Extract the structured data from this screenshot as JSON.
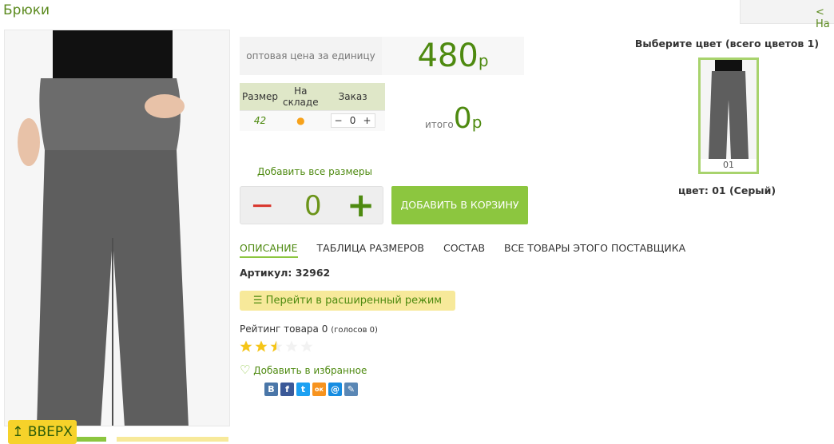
{
  "page": {
    "title": "Брюки",
    "back": "< На"
  },
  "price": {
    "label": "оптовая цена за единицу",
    "value": "480",
    "currency": "р"
  },
  "sizes": {
    "headers": [
      "Размер",
      "На складе",
      "Заказ"
    ],
    "rows": [
      {
        "size": "42",
        "stock": "●",
        "qty": "0",
        "minus": "−",
        "plus": "+"
      }
    ]
  },
  "total": {
    "label": "итого",
    "value": "0",
    "currency": "р"
  },
  "add_all_sizes": "Добавить все размеры",
  "big_stepper": {
    "minus": "−",
    "value": "0",
    "plus": "+"
  },
  "add_to_cart": "ДОБАВИТЬ В КОРЗИНУ",
  "tabs": [
    {
      "label": "ОПИСАНИЕ",
      "active": true
    },
    {
      "label": "ТАБЛИЦА РАЗМЕРОВ"
    },
    {
      "label": "СОСТАВ"
    },
    {
      "label": "ВСЕ ТОВАРЫ ЭТОГО ПОСТАВЩИКА"
    }
  ],
  "article": "Артикул: 32962",
  "advanced_mode": "Перейти в расширенный режим",
  "rating": {
    "text": "Рейтинг товара 0",
    "votes": "(голосов 0)",
    "stars": 2.5,
    "max": 5
  },
  "favorite": "Добавить в избранное",
  "share": [
    {
      "icon": "vk-icon",
      "glyph": "В",
      "color": "#4a76a8"
    },
    {
      "icon": "facebook-icon",
      "glyph": "f",
      "color": "#3b5998"
    },
    {
      "icon": "twitter-icon",
      "glyph": "t",
      "color": "#1da1f2"
    },
    {
      "icon": "odnoklassniki-icon",
      "glyph": "ок",
      "color": "#f7931e"
    },
    {
      "icon": "mailru-icon",
      "glyph": "@",
      "color": "#168de2"
    },
    {
      "icon": "livejournal-icon",
      "glyph": "✎",
      "color": "#5a87b5"
    }
  ],
  "colors": {
    "title": "Выберите цвет (всего цветов 1)",
    "swatch_label": "01",
    "selected": "цвет: 01 (Серый)"
  },
  "scroll_up": "↥ ВВЕРХ",
  "colors_theme": {
    "accent": "#8cc63f",
    "text_green": "#4e8a10",
    "minus_red": "#d9342b",
    "yellow": "#f7e99a"
  }
}
